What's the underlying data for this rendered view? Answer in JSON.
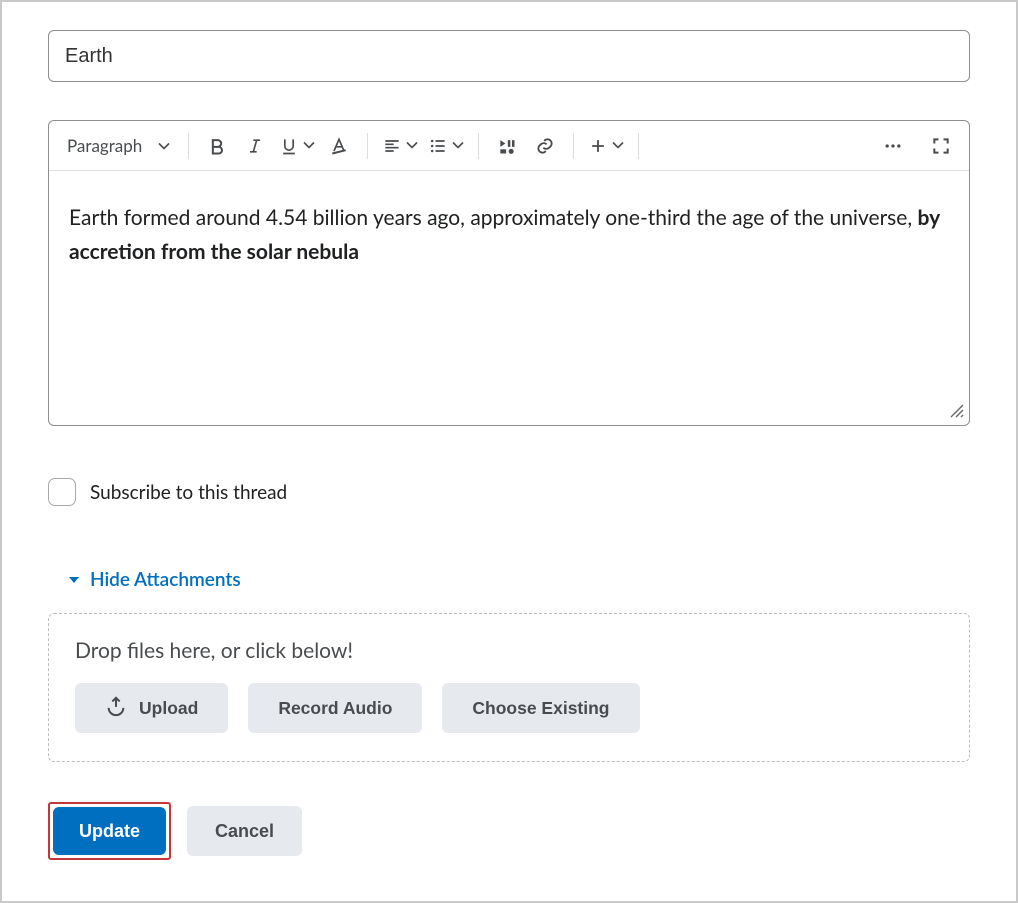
{
  "title_value": "Earth",
  "toolbar": {
    "block_format": "Paragraph"
  },
  "editor": {
    "text_plain": "Earth formed around 4.54 billion years ago, approximately one-third the age of the universe, ",
    "text_bold": "by accretion from the solar nebula"
  },
  "subscribe": {
    "label": "Subscribe to this thread",
    "checked": false
  },
  "attachments": {
    "toggle_label": "Hide Attachments",
    "dropzone_text": "Drop files here, or click below!",
    "upload_label": "Upload",
    "record_label": "Record Audio",
    "choose_label": "Choose Existing"
  },
  "footer": {
    "primary": "Update",
    "secondary": "Cancel"
  }
}
